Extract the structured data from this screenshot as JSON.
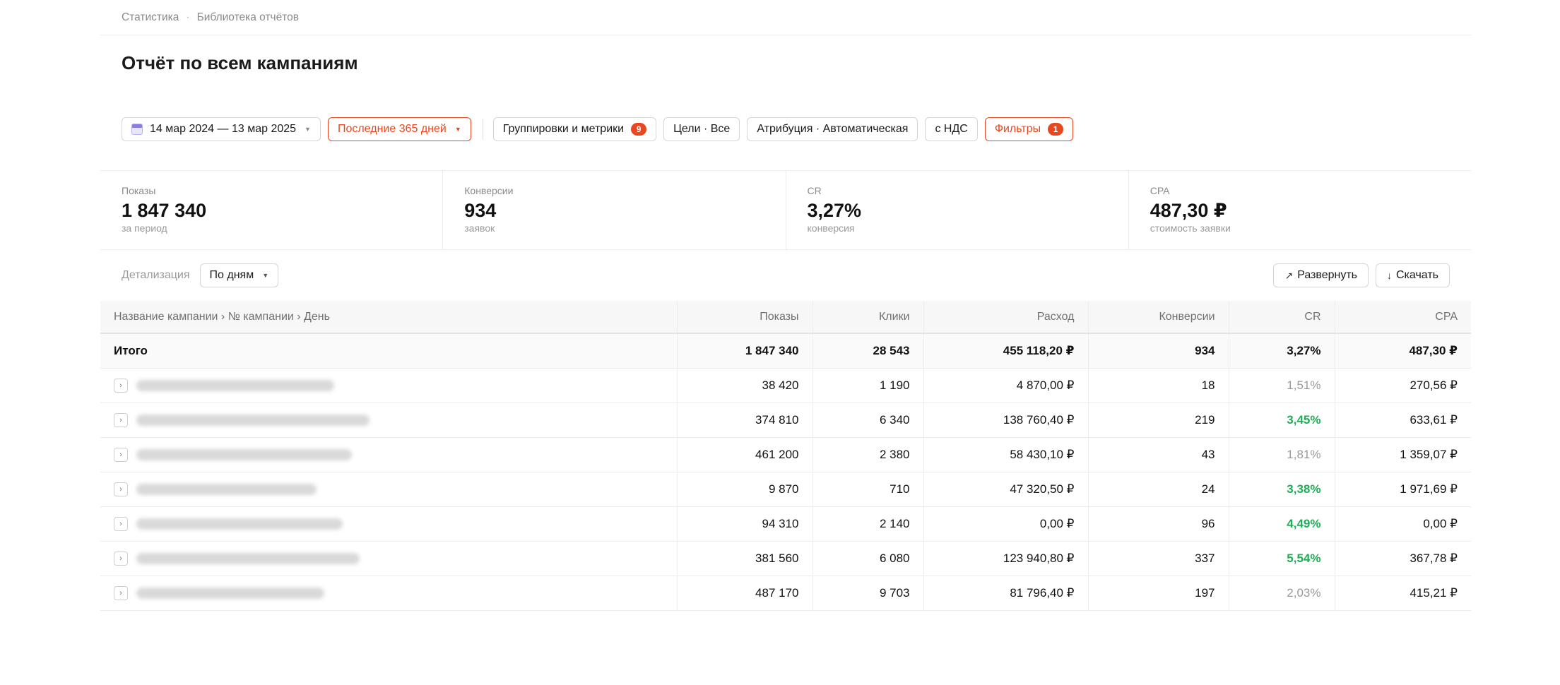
{
  "breadcrumbs": [
    "Статистика",
    "Библиотека отчётов"
  ],
  "breadcrumb_sep": "·",
  "page_title": "Отчёт по всем кампаниям",
  "toolbar": {
    "date_range": "14 мар 2024 — 13 мар 2025",
    "period": "Последние 365 дней",
    "groupings_label": "Группировки и метрики",
    "groupings_count": "9",
    "goals": "Цели · Все",
    "attribution": "Атрибуция · Автоматическая",
    "vat": "с НДС",
    "filters_label": "Фильтры",
    "filters_count": "1"
  },
  "kpis": [
    {
      "label": "Показы",
      "value": "1 847 340",
      "sub": "за период"
    },
    {
      "label": "Конверсии",
      "value": "934",
      "sub": "заявок"
    },
    {
      "label": "CR",
      "value": "3,27%",
      "sub": "конверсия"
    },
    {
      "label": "CPA",
      "value": "487,30 ₽",
      "sub": "стоимость заявки"
    }
  ],
  "detail": {
    "label": "Детализация",
    "value": "По дням",
    "expand_label": "Развернуть",
    "download_label": "Скачать"
  },
  "table": {
    "columns": [
      "Название кампании › № кампании › День",
      "Показы",
      "Клики",
      "Расход",
      "Конверсии",
      "CR",
      "CPA"
    ],
    "total": {
      "name": "Итого",
      "shows": "1 847 340",
      "clicks": "28 543",
      "spend": "455 118,20 ₽",
      "conv": "934",
      "cr": "3,27%",
      "cpa": "487,30 ₽"
    },
    "rows": [
      {
        "shows": "38 420",
        "clicks": "1 190",
        "spend": "4 870,00 ₽",
        "conv": "18",
        "cr": "1,51%",
        "cr_state": "low",
        "cpa": "270,56 ₽",
        "blur_w": 280
      },
      {
        "shows": "374 810",
        "clicks": "6 340",
        "spend": "138 760,40 ₽",
        "conv": "219",
        "cr": "3,45%",
        "cr_state": "high",
        "cpa": "633,61 ₽",
        "blur_w": 330
      },
      {
        "shows": "461 200",
        "clicks": "2 380",
        "spend": "58 430,10 ₽",
        "conv": "43",
        "cr": "1,81%",
        "cr_state": "low",
        "cpa": "1 359,07 ₽",
        "blur_w": 305
      },
      {
        "shows": "9 870",
        "clicks": "710",
        "spend": "47 320,50 ₽",
        "conv": "24",
        "cr": "3,38%",
        "cr_state": "high",
        "cpa": "1 971,69 ₽",
        "blur_w": 255
      },
      {
        "shows": "94 310",
        "clicks": "2 140",
        "spend": "0,00 ₽",
        "conv": "96",
        "cr": "4,49%",
        "cr_state": "high",
        "cpa": "0,00 ₽",
        "blur_w": 292
      },
      {
        "shows": "381 560",
        "clicks": "6 080",
        "spend": "123 940,80 ₽",
        "conv": "337",
        "cr": "5,54%",
        "cr_state": "high",
        "cpa": "367,78 ₽",
        "blur_w": 316
      },
      {
        "shows": "487 170",
        "clicks": "9 703",
        "spend": "81 796,40 ₽",
        "conv": "197",
        "cr": "2,03%",
        "cr_state": "low",
        "cpa": "415,21 ₽",
        "blur_w": 266
      }
    ]
  },
  "colors": {
    "accent": "#e8471f",
    "positive": "#1fae55",
    "muted": "#9a9a9a"
  }
}
